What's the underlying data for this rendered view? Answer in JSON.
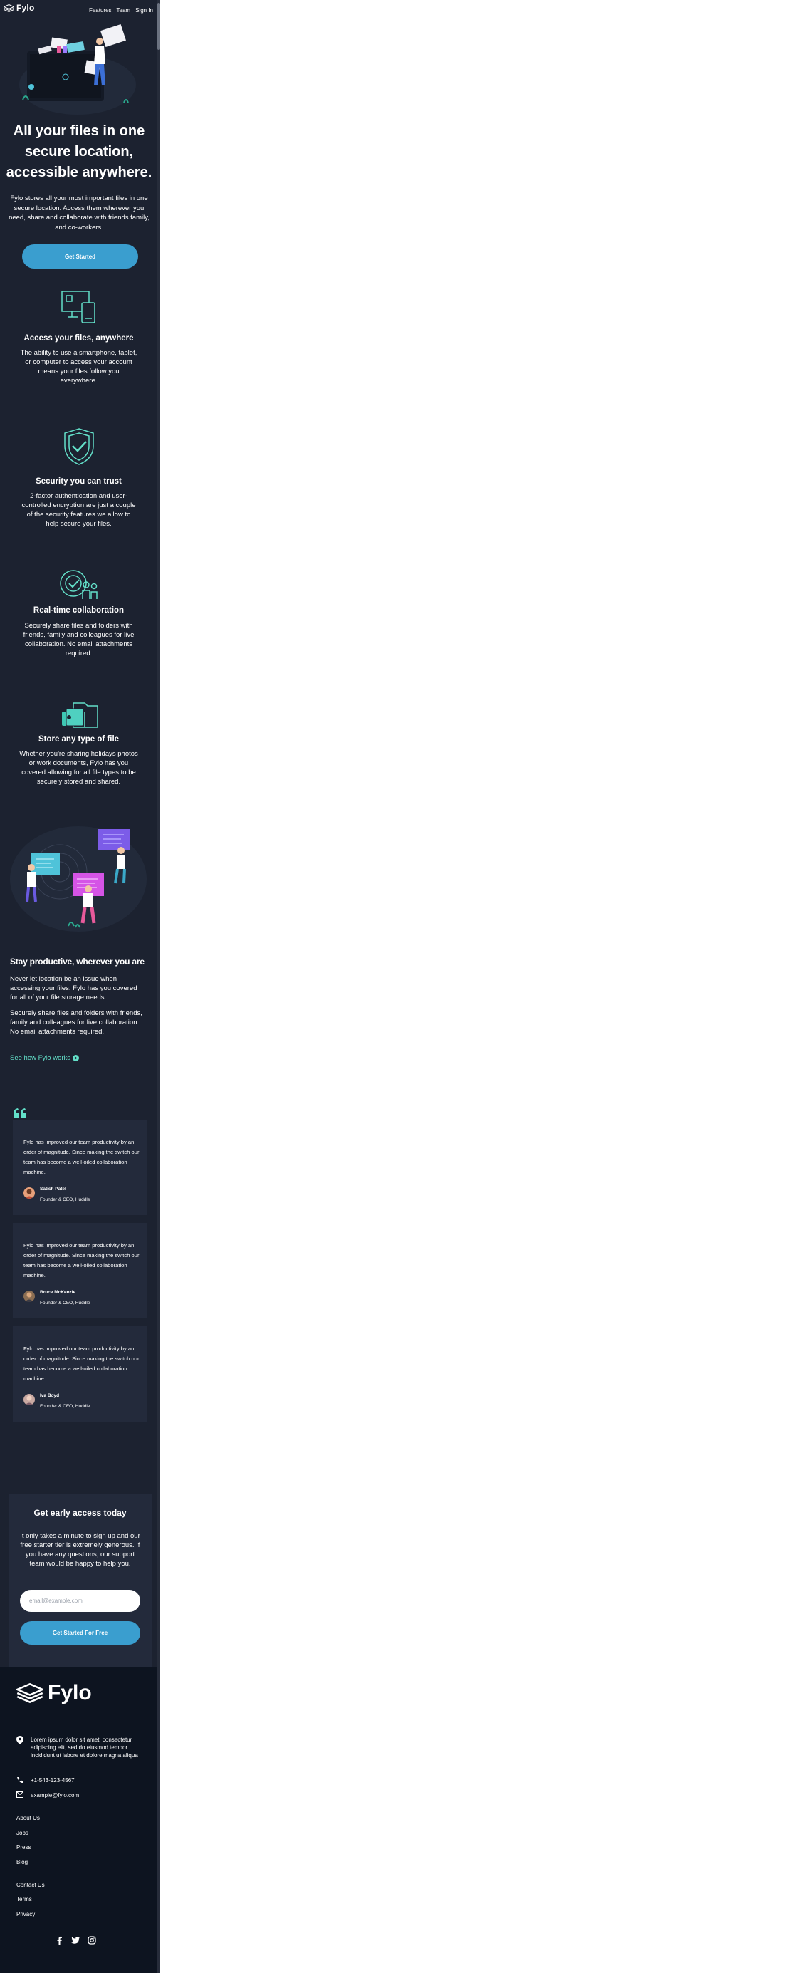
{
  "header": {
    "logo": "Fylo",
    "nav": [
      "Features",
      "Team",
      "Sign In"
    ]
  },
  "hero": {
    "title": "All your files in one secure location, accessible anywhere.",
    "text": "Fylo stores all your most important files in one secure location. Access them wherever you need, share and collaborate with friends family, and co-workers.",
    "cta": "Get Started"
  },
  "features": [
    {
      "title": "Access your files, anywhere",
      "text": "The ability to use a smartphone, tablet, or computer to access your account means your files follow you everywhere."
    },
    {
      "title": "Security you can trust",
      "text": "2-factor authentication and user-controlled encryption are just a couple of the security features we allow to help secure your files."
    },
    {
      "title": "Real-time collaboration",
      "text": "Securely share files and folders with friends, family and colleagues for live collaboration. No email attachments required."
    },
    {
      "title": "Store any type of file",
      "text": "Whether you're sharing holidays photos or work documents, Fylo has you covered allowing for all file types to be securely stored and shared."
    }
  ],
  "productive": {
    "title": "Stay productive, wherever you are",
    "p1": "Never let location be an issue when accessing your files. Fylo has you covered for all of your file storage needs.",
    "p2": "Securely share files and folders with friends, family and colleagues for live collaboration. No email attachments required.",
    "link": "See how Fylo works"
  },
  "testimonials": [
    {
      "quote": "Fylo has improved our team productivity by an order of magnitude. Since making the switch our team has become a well-oiled collaboration machine.",
      "name": "Satish Patel",
      "role": "Founder & CEO, Huddle"
    },
    {
      "quote": "Fylo has improved our team productivity by an order of magnitude. Since making the switch our team has become a well-oiled collaboration machine.",
      "name": "Bruce McKenzie",
      "role": "Founder & CEO, Huddle"
    },
    {
      "quote": "Fylo has improved our team productivity by an order of magnitude. Since making the switch our team has become a well-oiled collaboration machine.",
      "name": "Iva Boyd",
      "role": "Founder & CEO, Huddle"
    }
  ],
  "access": {
    "title": "Get early access today",
    "text": "It only takes a minute to sign up and our free starter tier is extremely generous. If you have any questions, our support team would be happy to help you.",
    "placeholder": "email@example.com",
    "cta": "Get Started For Free"
  },
  "footer": {
    "logo": "Fylo",
    "address": "Lorem ipsum dolor sit amet, consectetur adipiscing elit, sed do eiusmod tempor incididunt ut labore et dolore magna aliqua",
    "phone": "+1-543-123-4567",
    "email": "example@fylo.com",
    "links1": [
      "About Us",
      "Jobs",
      "Press",
      "Blog"
    ],
    "links2": [
      "Contact Us",
      "Terms",
      "Privacy"
    ]
  },
  "colors": {
    "background": "#1c2230",
    "footer_bg": "#0d1420",
    "card_bg": "#232a3b",
    "button": "#3a9ecf",
    "accent_link": "#63e0c9"
  }
}
